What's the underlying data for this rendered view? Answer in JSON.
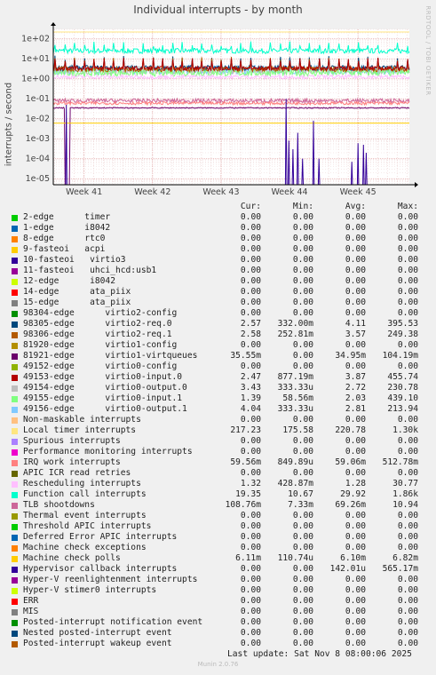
{
  "title": "Individual interrupts - by month",
  "ylabel": "interrupts / second",
  "watermark": "RRDTOOL / TOBI OETIKER",
  "footer": {
    "last_update": "Last update: Sat Nov  8 08:00:06 2025",
    "munin": "Munin 2.0.76"
  },
  "legend_headers": [
    "Cur:",
    "Min:",
    "Avg:",
    "Max:"
  ],
  "legend": [
    {
      "label": "2-edge      timer",
      "color": "#00cc00",
      "cur": "0.00",
      "min": "0.00",
      "avg": "0.00",
      "max": "0.00"
    },
    {
      "label": "1-edge      i8042",
      "color": "#0066b3",
      "cur": "0.00",
      "min": "0.00",
      "avg": "0.00",
      "max": "0.00"
    },
    {
      "label": "8-edge      rtc0",
      "color": "#ff8000",
      "cur": "0.00",
      "min": "0.00",
      "avg": "0.00",
      "max": "0.00"
    },
    {
      "label": "9-fasteoi   acpi",
      "color": "#ffcc00",
      "cur": "0.00",
      "min": "0.00",
      "avg": "0.00",
      "max": "0.00"
    },
    {
      "label": "10-fasteoi   virtio3",
      "color": "#330099",
      "cur": "0.00",
      "min": "0.00",
      "avg": "0.00",
      "max": "0.00"
    },
    {
      "label": "11-fasteoi   uhci_hcd:usb1",
      "color": "#990099",
      "cur": "0.00",
      "min": "0.00",
      "avg": "0.00",
      "max": "0.00"
    },
    {
      "label": "12-edge      i8042",
      "color": "#ccff00",
      "cur": "0.00",
      "min": "0.00",
      "avg": "0.00",
      "max": "0.00"
    },
    {
      "label": "14-edge      ata_piix",
      "color": "#ff0000",
      "cur": "0.00",
      "min": "0.00",
      "avg": "0.00",
      "max": "0.00"
    },
    {
      "label": "15-edge      ata_piix",
      "color": "#808080",
      "cur": "0.00",
      "min": "0.00",
      "avg": "0.00",
      "max": "0.00"
    },
    {
      "label": "98304-edge      virtio2-config",
      "color": "#008f00",
      "cur": "0.00",
      "min": "0.00",
      "avg": "0.00",
      "max": "0.00"
    },
    {
      "label": "98305-edge      virtio2-req.0",
      "color": "#00487d",
      "cur": "2.57",
      "min": "332.00m",
      "avg": "4.11",
      "max": "395.53"
    },
    {
      "label": "98306-edge      virtio2-req.1",
      "color": "#b35a00",
      "cur": "2.58",
      "min": "252.81m",
      "avg": "3.57",
      "max": "249.38"
    },
    {
      "label": "81920-edge      virtio1-config",
      "color": "#b38f00",
      "cur": "0.00",
      "min": "0.00",
      "avg": "0.00",
      "max": "0.00"
    },
    {
      "label": "81921-edge      virtio1-virtqueues",
      "color": "#6b006b",
      "cur": "35.55m",
      "min": "0.00",
      "avg": "34.95m",
      "max": "104.19m"
    },
    {
      "label": "49152-edge      virtio0-config",
      "color": "#8fb300",
      "cur": "0.00",
      "min": "0.00",
      "avg": "0.00",
      "max": "0.00"
    },
    {
      "label": "49153-edge      virtio0-input.0",
      "color": "#b30000",
      "cur": "2.47",
      "min": "877.19m",
      "avg": "3.87",
      "max": "455.74"
    },
    {
      "label": "49154-edge      virtio0-output.0",
      "color": "#bebebe",
      "cur": "3.43",
      "min": "333.33u",
      "avg": "2.72",
      "max": "230.78"
    },
    {
      "label": "49155-edge      virtio0-input.1",
      "color": "#80ff80",
      "cur": "1.39",
      "min": "58.56m",
      "avg": "2.03",
      "max": "439.10"
    },
    {
      "label": "49156-edge      virtio0-output.1",
      "color": "#80c9ff",
      "cur": "4.04",
      "min": "333.33u",
      "avg": "2.81",
      "max": "213.94"
    },
    {
      "label": "Non-maskable interrupts",
      "color": "#ffc080",
      "cur": "0.00",
      "min": "0.00",
      "avg": "0.00",
      "max": "0.00"
    },
    {
      "label": "Local timer interrupts",
      "color": "#ffe680",
      "cur": "217.23",
      "min": "175.58",
      "avg": "220.78",
      "max": "1.30k"
    },
    {
      "label": "Spurious interrupts",
      "color": "#aa80ff",
      "cur": "0.00",
      "min": "0.00",
      "avg": "0.00",
      "max": "0.00"
    },
    {
      "label": "Performance monitoring interrupts",
      "color": "#ee00cc",
      "cur": "0.00",
      "min": "0.00",
      "avg": "0.00",
      "max": "0.00"
    },
    {
      "label": "IRQ work interrupts",
      "color": "#ff8080",
      "cur": "59.56m",
      "min": "849.89u",
      "avg": "59.06m",
      "max": "512.78m"
    },
    {
      "label": "APIC ICR read retries",
      "color": "#666600",
      "cur": "0.00",
      "min": "0.00",
      "avg": "0.00",
      "max": "0.00"
    },
    {
      "label": "Rescheduling interrupts",
      "color": "#ffbfff",
      "cur": "1.32",
      "min": "428.87m",
      "avg": "1.28",
      "max": "30.77"
    },
    {
      "label": "Function call interrupts",
      "color": "#00ffcc",
      "cur": "19.35",
      "min": "10.67",
      "avg": "29.92",
      "max": "1.86k"
    },
    {
      "label": "TLB shootdowns",
      "color": "#cc6699",
      "cur": "108.76m",
      "min": "7.33m",
      "avg": "69.26m",
      "max": "10.94"
    },
    {
      "label": "Thermal event interrupts",
      "color": "#999900",
      "cur": "0.00",
      "min": "0.00",
      "avg": "0.00",
      "max": "0.00"
    },
    {
      "label": "Threshold APIC interrupts",
      "color": "#00cc00",
      "cur": "0.00",
      "min": "0.00",
      "avg": "0.00",
      "max": "0.00"
    },
    {
      "label": "Deferred Error APIC interrupts",
      "color": "#0066b3",
      "cur": "0.00",
      "min": "0.00",
      "avg": "0.00",
      "max": "0.00"
    },
    {
      "label": "Machine check exceptions",
      "color": "#ff8000",
      "cur": "0.00",
      "min": "0.00",
      "avg": "0.00",
      "max": "0.00"
    },
    {
      "label": "Machine check polls",
      "color": "#ffcc00",
      "cur": "6.11m",
      "min": "110.74u",
      "avg": "6.10m",
      "max": "6.82m"
    },
    {
      "label": "Hypervisor callback interrupts",
      "color": "#330099",
      "cur": "0.00",
      "min": "0.00",
      "avg": "142.01u",
      "max": "565.17m"
    },
    {
      "label": "Hyper-V reenlightenment interrupts",
      "color": "#990099",
      "cur": "0.00",
      "min": "0.00",
      "avg": "0.00",
      "max": "0.00"
    },
    {
      "label": "Hyper-V stimer0 interrupts",
      "color": "#ccff00",
      "cur": "0.00",
      "min": "0.00",
      "avg": "0.00",
      "max": "0.00"
    },
    {
      "label": "ERR",
      "color": "#ff0000",
      "cur": "0.00",
      "min": "0.00",
      "avg": "0.00",
      "max": "0.00"
    },
    {
      "label": "MIS",
      "color": "#808080",
      "cur": "0.00",
      "min": "0.00",
      "avg": "0.00",
      "max": "0.00"
    },
    {
      "label": "Posted-interrupt notification event",
      "color": "#008f00",
      "cur": "0.00",
      "min": "0.00",
      "avg": "0.00",
      "max": "0.00"
    },
    {
      "label": "Nested posted-interrupt event",
      "color": "#00487d",
      "cur": "0.00",
      "min": "0.00",
      "avg": "0.00",
      "max": "0.00"
    },
    {
      "label": "Posted-interrupt wakeup event",
      "color": "#b35a00",
      "cur": "0.00",
      "min": "0.00",
      "avg": "0.00",
      "max": "0.00"
    }
  ],
  "chart_data": {
    "type": "line",
    "title": "Individual interrupts - by month",
    "ylabel": "interrupts / second",
    "xlabel": "",
    "scale": "log",
    "ylim": [
      5e-06,
      300
    ],
    "yticks": [
      100,
      10,
      1,
      0.1,
      0.01,
      0.001,
      0.0001,
      1e-05
    ],
    "ytick_labels": [
      "1e+02",
      "1e+01",
      "1e+00",
      "1e-01",
      "1e-02",
      "1e-03",
      "1e-04",
      "1e-05"
    ],
    "xticks": [
      41,
      42,
      43,
      44,
      45
    ],
    "xtick_labels": [
      "Week 41",
      "Week 42",
      "Week 43",
      "Week 44",
      "Week 45"
    ],
    "xlim": [
      40.55,
      45.75
    ],
    "grid": true,
    "series": [
      {
        "name": "Local timer interrupts",
        "color": "#ffe680",
        "kind": "flat",
        "base": 220
      },
      {
        "name": "Function call interrupts",
        "color": "#00ffcc",
        "kind": "spiky",
        "base": 25,
        "amp": 0.25,
        "spike": 0.35
      },
      {
        "name": "49156-edge      virtio0-output.1",
        "color": "#80c9ff",
        "kind": "noisy",
        "base": 2.8,
        "amp": 0.45
      },
      {
        "name": "49154-edge      virtio0-output.0",
        "color": "#bebebe",
        "kind": "noisy",
        "base": 2.7,
        "amp": 0.4
      },
      {
        "name": "49155-edge      virtio0-input.1",
        "color": "#80ff80",
        "kind": "noisy",
        "base": 2.0,
        "amp": 0.35
      },
      {
        "name": "98305-edge      virtio2-req.0",
        "color": "#00487d",
        "kind": "spiky",
        "base": 3.5,
        "amp": 0.25,
        "spike": 0.5
      },
      {
        "name": "98306-edge      virtio2-req.1",
        "color": "#b35a00",
        "kind": "spiky",
        "base": 3.0,
        "amp": 0.25,
        "spike": 0.5
      },
      {
        "name": "49153-edge      virtio0-input.0",
        "color": "#b30000",
        "kind": "spiky",
        "base": 3.3,
        "amp": 0.2,
        "spike": 0.45
      },
      {
        "name": "Rescheduling interrupts",
        "color": "#ffbfff",
        "kind": "noisy",
        "base": 1.25,
        "amp": 0.2
      },
      {
        "name": "TLB shootdowns",
        "color": "#cc6699",
        "kind": "noisy",
        "base": 0.08,
        "amp": 0.2
      },
      {
        "name": "IRQ work interrupts",
        "color": "#ff8080",
        "kind": "noisy",
        "base": 0.06,
        "amp": 0.15
      },
      {
        "name": "81921-edge      virtio1-virtqueues",
        "color": "#6b006b",
        "kind": "drop",
        "base": 0.035,
        "amp": 0.05,
        "drop": [
          40.72,
          40.79
        ]
      },
      {
        "name": "Machine check polls",
        "color": "#ffcc00",
        "kind": "flat",
        "base": 0.0061
      },
      {
        "name": "Hypervisor callback interrupts",
        "color": "#330099",
        "kind": "sparse",
        "base": 5e-06,
        "spikes": [
          [
            40.74,
            0.05
          ],
          [
            43.95,
            0.1
          ],
          [
            43.99,
            0.0008
          ],
          [
            44.05,
            0.0003
          ],
          [
            44.12,
            0.002
          ],
          [
            44.19,
            0.0001
          ],
          [
            44.35,
            0.008
          ],
          [
            44.43,
            0.0001
          ],
          [
            44.91,
            7e-05
          ],
          [
            45.0,
            0.0006
          ],
          [
            45.08,
            0.0005
          ],
          [
            45.12,
            0.0002
          ]
        ]
      }
    ]
  }
}
